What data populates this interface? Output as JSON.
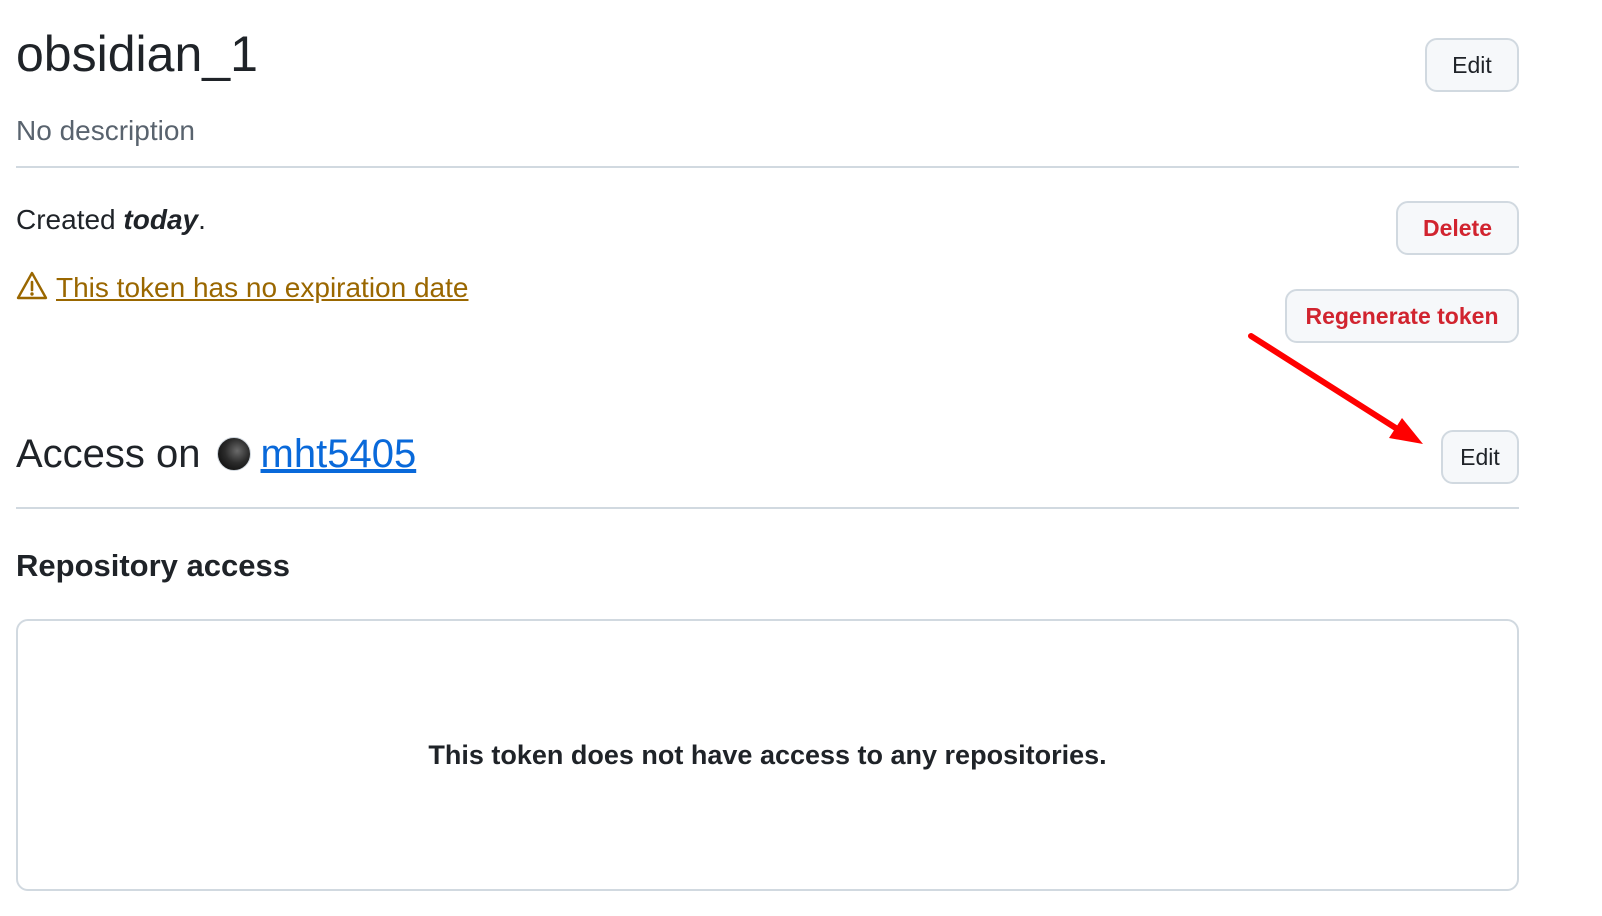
{
  "token": {
    "name": "obsidian_1",
    "description": "No description",
    "edit_label": "Edit"
  },
  "created": {
    "prefix": "Created ",
    "when": "today",
    "suffix": "."
  },
  "warning": {
    "icon": "alert-triangle-icon",
    "text": "This token has no expiration date"
  },
  "actions": {
    "delete_label": "Delete",
    "regenerate_label": "Regenerate token"
  },
  "access": {
    "label": "Access on",
    "owner": "mht5405",
    "edit_label": "Edit"
  },
  "repository_access": {
    "title": "Repository access",
    "empty_message": "This token does not have access to any repositories."
  },
  "colors": {
    "danger": "#d1242f",
    "warning": "#9a6700",
    "link": "#0969da",
    "annotation_arrow": "#ff0000"
  }
}
